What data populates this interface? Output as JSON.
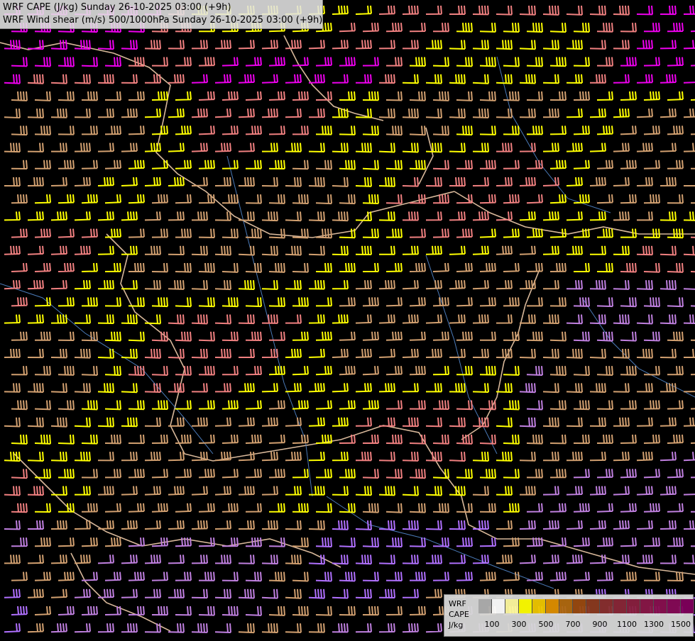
{
  "header": {
    "line1": "WRF CAPE (J/kg) Sunday 26-10-2025 03:00 (+9h)",
    "line2": "WRF Wind shear (m/s) 500/1000hPa Sunday 26-10-2025 03:00 (+9h)"
  },
  "legend": {
    "model": "WRF",
    "variable": "CAPE",
    "unit": "J/kg",
    "colors": [
      "#b0b0b0",
      "#ffffff",
      "#fffaa0",
      "#ffff00",
      "#f0c800",
      "#e09000",
      "#b06a10",
      "#9a4a10",
      "#8c3a20",
      "#8a3030",
      "#8a2838",
      "#8a2040",
      "#8a1848",
      "#881050",
      "#860a58",
      "#80005c"
    ],
    "tick_labels": [
      "100",
      "300",
      "500",
      "700",
      "900",
      "1100",
      "1300",
      "1500"
    ]
  },
  "map": {
    "barb_palette": [
      "#ffff00",
      "#ff66ff",
      "#ee00ee",
      "#f08080",
      "#d2a070",
      "#c080e0",
      "#b070ff"
    ]
  }
}
